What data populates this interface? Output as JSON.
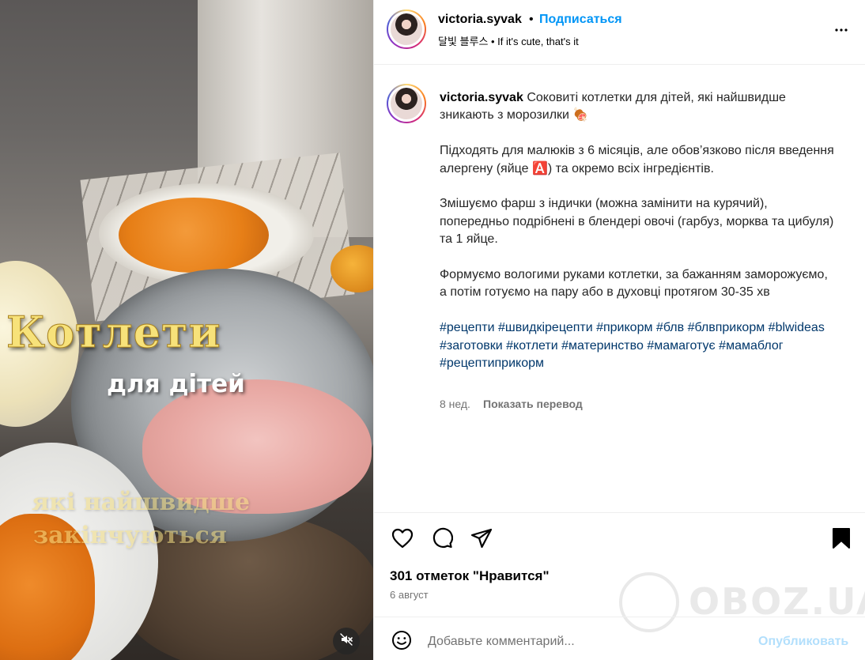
{
  "media": {
    "overlay_title": "Котлети",
    "overlay_subtitle": "для дітей",
    "overlay_line1": "які найшвидше",
    "overlay_line2": "закінчуються",
    "mute_icon": "speaker-muted-icon"
  },
  "header": {
    "username": "victoria.syvak",
    "separator": "•",
    "follow_label": "Подписаться",
    "subtitle": "달빛 블루스 • If it's cute, that's it",
    "more_icon": "more-horizontal-icon"
  },
  "caption": {
    "username": "victoria.syvak",
    "p1": "Соковиті котлетки для дітей, які найшвидше зникають з морозилки 🍖",
    "p2": "Підходять для малюків з 6 місяців, але обов’язково після введення алергену (яйце 🅰️) та окремо всіх інгредієнтів.",
    "p3": "Змішуємо фарш з індички (можна замінити на курячий), попередньо подрібнені в блендері овочі (гарбуз, морква та цибуля) та 1 яйце.",
    "p4": "Формуємо вологими руками котлетки, за бажанням заморожуємо, а потім готуємо на пару або в духовці протягом 30-35 хв",
    "hashtags": [
      "#рецепти",
      "#швидкірецепти",
      "#прикорм",
      "#блв",
      "#блвприкорм",
      "#blwideas",
      "#заготовки",
      "#котлети",
      "#материнство",
      "#мамаготує",
      "#мамаблог",
      "#рецептиприкорм"
    ],
    "age": "8 нед.",
    "translate_label": "Показать перевод"
  },
  "actions": {
    "like_icon": "heart-icon",
    "comment_icon": "comment-icon",
    "share_icon": "share-icon",
    "save_icon": "bookmark-icon",
    "likes_text": "301 отметок \"Нравится\"",
    "date_text": "6 август"
  },
  "comment": {
    "emoji_icon": "emoji-icon",
    "placeholder": "Добавьте комментарий...",
    "publish_label": "Опубликовать"
  },
  "watermark": {
    "text": "OBOZ.UA"
  },
  "colors": {
    "link_blue": "#0095f6",
    "hashtag_blue": "#00376b",
    "publish_disabled": "#b2dffc",
    "muted_text": "#737373"
  }
}
